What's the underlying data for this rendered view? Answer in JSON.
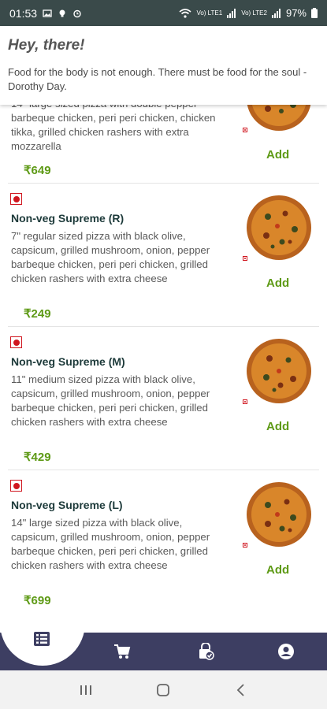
{
  "status_bar": {
    "time": "01:53",
    "battery": "97%",
    "network_label_1": "Vo) LTE1",
    "network_label_2": "Vo) LTE2"
  },
  "header": {
    "greeting": "Hey, there!",
    "quote": "Food for the body is not enough. There must be food for the soul - Dorothy Day."
  },
  "menu": {
    "add_label": "Add",
    "items": [
      {
        "name": "",
        "description": "14\" large sized pizza with double pepper barbeque chicken, peri peri chicken, chicken tikka, grilled chicken rashers with extra mozzarella",
        "price": "₹649"
      },
      {
        "name": "Non-veg Supreme (R)",
        "description": "7\" regular sized pizza with black olive, capsicum, grilled mushroom, onion, pepper barbeque chicken, peri peri chicken, grilled chicken rashers with extra cheese",
        "price": "₹249"
      },
      {
        "name": "Non-veg Supreme (M)",
        "description": "11\" medium sized pizza with black olive, capsicum, grilled mushroom, onion, pepper barbeque chicken, peri peri chicken, grilled chicken rashers with extra cheese",
        "price": "₹429"
      },
      {
        "name": "Non-veg Supreme (L)",
        "description": "14\" large sized pizza with black olive, capsicum, grilled mushroom, onion, pepper barbeque chicken, peri peri chicken, grilled chicken rashers with extra cheese",
        "price": "₹699"
      }
    ]
  },
  "bottom_nav": {
    "items": [
      "menu-list-icon",
      "cart-icon",
      "order-status-icon",
      "profile-icon"
    ],
    "background": "#3d3e62"
  },
  "colors": {
    "accent_green": "#5e9a16",
    "nonveg_red": "#d0161f",
    "status_bar": "#3a4a4a"
  }
}
